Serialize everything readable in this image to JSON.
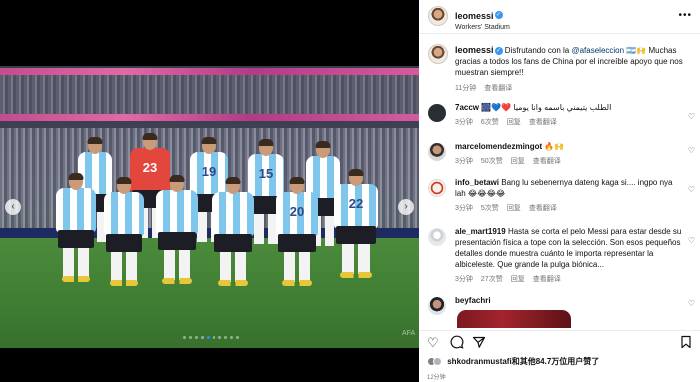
{
  "post": {
    "username": "leomessi",
    "location": "Workers' Stadium",
    "more_glyph": "•••",
    "caption_text": "Disfrutando con la",
    "caption_mention": "@afaseleccion",
    "caption_emoji": "🇦🇷🙌",
    "caption_rest": "Muchas gracias a todos los fans de China por el increíble apoyo que nos muestran siempre!!",
    "caption_time": "11分钟",
    "caption_translate": "查看翻译"
  },
  "comments": [
    {
      "username": "7accw",
      "emoji": "🎆💙❤️",
      "text": "الطلب يتيمني باسمه وانا يوميا",
      "time": "3分钟",
      "likes": "6次赞",
      "reply": "回复",
      "translate": "查看翻译"
    },
    {
      "username": "marcelomendezmingot",
      "emoji": "",
      "text": "🔥🙌",
      "time": "3分钟",
      "likes": "50次赞",
      "reply": "回复",
      "translate": "查看翻译"
    },
    {
      "username": "info_betawi",
      "emoji": "",
      "text": "Bang lu sebenernya dateng kaga si.... ingpo nya lah 😂😂😂😂",
      "time": "3分钟",
      "likes": "5次赞",
      "reply": "回复",
      "translate": "查看翻译"
    },
    {
      "username": "ale_mart1919",
      "emoji": "",
      "text": "Hasta se corta el pelo Messi para estar desde su presentación física a tope con la selección. Son esos pequeños detalles donde muestra cuánto le importa representar la albiceleste. Que grande la pulga biónica...",
      "time": "3分钟",
      "likes": "27次赞",
      "reply": "回复",
      "translate": "查看翻译"
    },
    {
      "username": "beyfachri",
      "emoji": "",
      "text": "",
      "time": "",
      "likes": "",
      "reply": "",
      "translate": ""
    }
  ],
  "actions": {
    "heart_icon": "heart-outline",
    "comment_icon": "speech-bubble",
    "share_icon": "paper-plane",
    "save_icon": "bookmark"
  },
  "likes_line": {
    "user": "shkodranmustafi",
    "rest": "和其他84.7万位用户赞了"
  },
  "post_time": "12分钟",
  "photo": {
    "shirt_numbers": [
      "23",
      "19",
      "15",
      "20",
      "22"
    ],
    "watermark": "AFA",
    "carousel_count": 10,
    "carousel_active": 4
  },
  "colors": {
    "verified": "#3897f0",
    "mention": "#00376b",
    "meta_gray": "#737373",
    "argentina_light_blue": "#7ec6ec"
  }
}
